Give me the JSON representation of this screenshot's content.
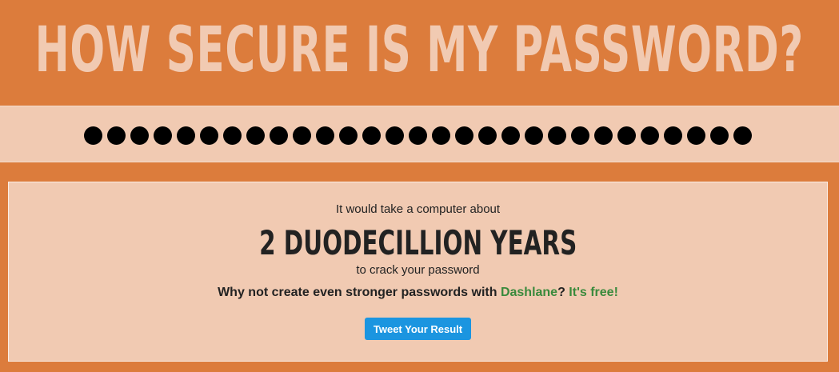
{
  "header": {
    "title": "HOW SECURE IS MY PASSWORD?"
  },
  "password": {
    "masked_length": 29,
    "value": "•••••••••••••••••••••••••••••"
  },
  "result": {
    "lead": "It would take a computer about",
    "duration": "2 DUODECILLION YEARS",
    "trail": "to crack your password",
    "cta_prefix": "Why not create even stronger passwords with ",
    "cta_link": "Dashlane",
    "cta_mid": "? ",
    "cta_free": "It's free!",
    "tweet_label": "Tweet Your Result"
  },
  "colors": {
    "background": "#dc7c3c",
    "panel": "#f1cab2",
    "link": "#3a8a3c",
    "button": "#1b95e0"
  }
}
